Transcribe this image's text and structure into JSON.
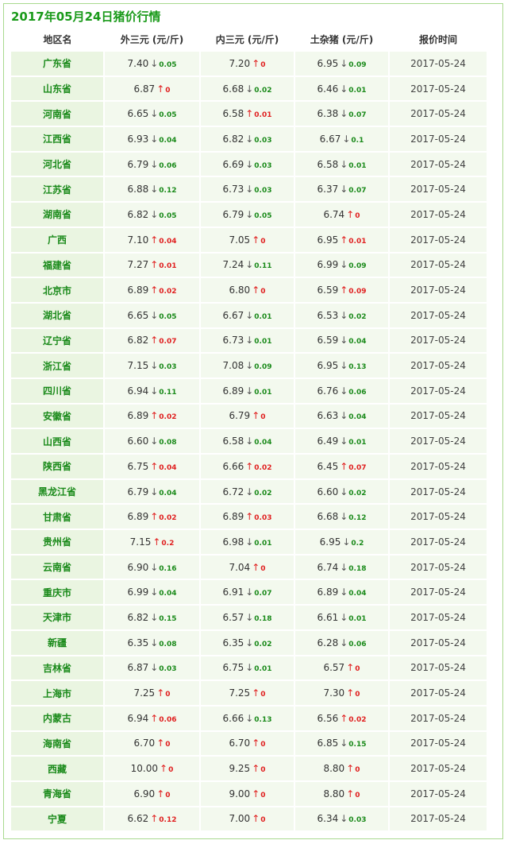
{
  "title": "2017年05月24日猪价行情",
  "headers": [
    "地区名",
    "外三元 (元/斤)",
    "内三元 (元/斤)",
    "土杂猪 (元/斤)",
    "报价时间"
  ],
  "colors": {
    "accent": "#1a9a1a",
    "up": "#e02020",
    "down": "#1a8a1a",
    "row_bg": "#f3f9ee",
    "border": "#a9d98e"
  },
  "rows": [
    {
      "region": "广东省",
      "c1": {
        "v": "7.40",
        "d": "down",
        "c": "0.05"
      },
      "c2": {
        "v": "7.20",
        "d": "up",
        "c": "0"
      },
      "c3": {
        "v": "6.95",
        "d": "down",
        "c": "0.09"
      },
      "date": "2017-05-24"
    },
    {
      "region": "山东省",
      "c1": {
        "v": "6.87",
        "d": "up",
        "c": "0"
      },
      "c2": {
        "v": "6.68",
        "d": "down",
        "c": "0.02"
      },
      "c3": {
        "v": "6.46",
        "d": "down",
        "c": "0.01"
      },
      "date": "2017-05-24"
    },
    {
      "region": "河南省",
      "c1": {
        "v": "6.65",
        "d": "down",
        "c": "0.05"
      },
      "c2": {
        "v": "6.58",
        "d": "up",
        "c": "0.01"
      },
      "c3": {
        "v": "6.38",
        "d": "down",
        "c": "0.07"
      },
      "date": "2017-05-24"
    },
    {
      "region": "江西省",
      "c1": {
        "v": "6.93",
        "d": "down",
        "c": "0.04"
      },
      "c2": {
        "v": "6.82",
        "d": "down",
        "c": "0.03"
      },
      "c3": {
        "v": "6.67",
        "d": "down",
        "c": "0.1"
      },
      "date": "2017-05-24"
    },
    {
      "region": "河北省",
      "c1": {
        "v": "6.79",
        "d": "down",
        "c": "0.06"
      },
      "c2": {
        "v": "6.69",
        "d": "down",
        "c": "0.03"
      },
      "c3": {
        "v": "6.58",
        "d": "down",
        "c": "0.01"
      },
      "date": "2017-05-24"
    },
    {
      "region": "江苏省",
      "c1": {
        "v": "6.88",
        "d": "down",
        "c": "0.12"
      },
      "c2": {
        "v": "6.73",
        "d": "down",
        "c": "0.03"
      },
      "c3": {
        "v": "6.37",
        "d": "down",
        "c": "0.07"
      },
      "date": "2017-05-24"
    },
    {
      "region": "湖南省",
      "c1": {
        "v": "6.82",
        "d": "down",
        "c": "0.05"
      },
      "c2": {
        "v": "6.79",
        "d": "down",
        "c": "0.05"
      },
      "c3": {
        "v": "6.74",
        "d": "up",
        "c": "0"
      },
      "date": "2017-05-24"
    },
    {
      "region": "广西",
      "c1": {
        "v": "7.10",
        "d": "up",
        "c": "0.04"
      },
      "c2": {
        "v": "7.05",
        "d": "up",
        "c": "0"
      },
      "c3": {
        "v": "6.95",
        "d": "up",
        "c": "0.01"
      },
      "date": "2017-05-24"
    },
    {
      "region": "福建省",
      "c1": {
        "v": "7.27",
        "d": "up",
        "c": "0.01"
      },
      "c2": {
        "v": "7.24",
        "d": "down",
        "c": "0.11"
      },
      "c3": {
        "v": "6.99",
        "d": "down",
        "c": "0.09"
      },
      "date": "2017-05-24"
    },
    {
      "region": "北京市",
      "c1": {
        "v": "6.89",
        "d": "up",
        "c": "0.02"
      },
      "c2": {
        "v": "6.80",
        "d": "up",
        "c": "0"
      },
      "c3": {
        "v": "6.59",
        "d": "up",
        "c": "0.09"
      },
      "date": "2017-05-24"
    },
    {
      "region": "湖北省",
      "c1": {
        "v": "6.65",
        "d": "down",
        "c": "0.05"
      },
      "c2": {
        "v": "6.67",
        "d": "down",
        "c": "0.01"
      },
      "c3": {
        "v": "6.53",
        "d": "down",
        "c": "0.02"
      },
      "date": "2017-05-24"
    },
    {
      "region": "辽宁省",
      "c1": {
        "v": "6.82",
        "d": "up",
        "c": "0.07"
      },
      "c2": {
        "v": "6.73",
        "d": "down",
        "c": "0.01"
      },
      "c3": {
        "v": "6.59",
        "d": "down",
        "c": "0.04"
      },
      "date": "2017-05-24"
    },
    {
      "region": "浙江省",
      "c1": {
        "v": "7.15",
        "d": "down",
        "c": "0.03"
      },
      "c2": {
        "v": "7.08",
        "d": "down",
        "c": "0.09"
      },
      "c3": {
        "v": "6.95",
        "d": "down",
        "c": "0.13"
      },
      "date": "2017-05-24"
    },
    {
      "region": "四川省",
      "c1": {
        "v": "6.94",
        "d": "down",
        "c": "0.11"
      },
      "c2": {
        "v": "6.89",
        "d": "down",
        "c": "0.01"
      },
      "c3": {
        "v": "6.76",
        "d": "down",
        "c": "0.06"
      },
      "date": "2017-05-24"
    },
    {
      "region": "安徽省",
      "c1": {
        "v": "6.89",
        "d": "up",
        "c": "0.02"
      },
      "c2": {
        "v": "6.79",
        "d": "up",
        "c": "0"
      },
      "c3": {
        "v": "6.63",
        "d": "down",
        "c": "0.04"
      },
      "date": "2017-05-24"
    },
    {
      "region": "山西省",
      "c1": {
        "v": "6.60",
        "d": "down",
        "c": "0.08"
      },
      "c2": {
        "v": "6.58",
        "d": "down",
        "c": "0.04"
      },
      "c3": {
        "v": "6.49",
        "d": "down",
        "c": "0.01"
      },
      "date": "2017-05-24"
    },
    {
      "region": "陕西省",
      "c1": {
        "v": "6.75",
        "d": "up",
        "c": "0.04"
      },
      "c2": {
        "v": "6.66",
        "d": "up",
        "c": "0.02"
      },
      "c3": {
        "v": "6.45",
        "d": "up",
        "c": "0.07"
      },
      "date": "2017-05-24"
    },
    {
      "region": "黑龙江省",
      "c1": {
        "v": "6.79",
        "d": "down",
        "c": "0.04"
      },
      "c2": {
        "v": "6.72",
        "d": "down",
        "c": "0.02"
      },
      "c3": {
        "v": "6.60",
        "d": "down",
        "c": "0.02"
      },
      "date": "2017-05-24"
    },
    {
      "region": "甘肃省",
      "c1": {
        "v": "6.89",
        "d": "up",
        "c": "0.02"
      },
      "c2": {
        "v": "6.89",
        "d": "up",
        "c": "0.03"
      },
      "c3": {
        "v": "6.68",
        "d": "down",
        "c": "0.12"
      },
      "date": "2017-05-24"
    },
    {
      "region": "贵州省",
      "c1": {
        "v": "7.15",
        "d": "up",
        "c": "0.2"
      },
      "c2": {
        "v": "6.98",
        "d": "down",
        "c": "0.01"
      },
      "c3": {
        "v": "6.95",
        "d": "down",
        "c": "0.2"
      },
      "date": "2017-05-24"
    },
    {
      "region": "云南省",
      "c1": {
        "v": "6.90",
        "d": "down",
        "c": "0.16"
      },
      "c2": {
        "v": "7.04",
        "d": "up",
        "c": "0"
      },
      "c3": {
        "v": "6.74",
        "d": "down",
        "c": "0.18"
      },
      "date": "2017-05-24"
    },
    {
      "region": "重庆市",
      "c1": {
        "v": "6.99",
        "d": "down",
        "c": "0.04"
      },
      "c2": {
        "v": "6.91",
        "d": "down",
        "c": "0.07"
      },
      "c3": {
        "v": "6.89",
        "d": "down",
        "c": "0.04"
      },
      "date": "2017-05-24"
    },
    {
      "region": "天津市",
      "c1": {
        "v": "6.82",
        "d": "down",
        "c": "0.15"
      },
      "c2": {
        "v": "6.57",
        "d": "down",
        "c": "0.18"
      },
      "c3": {
        "v": "6.61",
        "d": "down",
        "c": "0.01"
      },
      "date": "2017-05-24"
    },
    {
      "region": "新疆",
      "c1": {
        "v": "6.35",
        "d": "down",
        "c": "0.08"
      },
      "c2": {
        "v": "6.35",
        "d": "down",
        "c": "0.02"
      },
      "c3": {
        "v": "6.28",
        "d": "down",
        "c": "0.06"
      },
      "date": "2017-05-24"
    },
    {
      "region": "吉林省",
      "c1": {
        "v": "6.87",
        "d": "down",
        "c": "0.03"
      },
      "c2": {
        "v": "6.75",
        "d": "down",
        "c": "0.01"
      },
      "c3": {
        "v": "6.57",
        "d": "up",
        "c": "0"
      },
      "date": "2017-05-24"
    },
    {
      "region": "上海市",
      "c1": {
        "v": "7.25",
        "d": "up",
        "c": "0"
      },
      "c2": {
        "v": "7.25",
        "d": "up",
        "c": "0"
      },
      "c3": {
        "v": "7.30",
        "d": "up",
        "c": "0"
      },
      "date": "2017-05-24"
    },
    {
      "region": "内蒙古",
      "c1": {
        "v": "6.94",
        "d": "up",
        "c": "0.06"
      },
      "c2": {
        "v": "6.66",
        "d": "down",
        "c": "0.13"
      },
      "c3": {
        "v": "6.56",
        "d": "up",
        "c": "0.02"
      },
      "date": "2017-05-24"
    },
    {
      "region": "海南省",
      "c1": {
        "v": "6.70",
        "d": "up",
        "c": "0"
      },
      "c2": {
        "v": "6.70",
        "d": "up",
        "c": "0"
      },
      "c3": {
        "v": "6.85",
        "d": "down",
        "c": "0.15"
      },
      "date": "2017-05-24"
    },
    {
      "region": "西藏",
      "c1": {
        "v": "10.00",
        "d": "up",
        "c": "0"
      },
      "c2": {
        "v": "9.25",
        "d": "up",
        "c": "0"
      },
      "c3": {
        "v": "8.80",
        "d": "up",
        "c": "0"
      },
      "date": "2017-05-24"
    },
    {
      "region": "青海省",
      "c1": {
        "v": "6.90",
        "d": "up",
        "c": "0"
      },
      "c2": {
        "v": "9.00",
        "d": "up",
        "c": "0"
      },
      "c3": {
        "v": "8.80",
        "d": "up",
        "c": "0"
      },
      "date": "2017-05-24"
    },
    {
      "region": "宁夏",
      "c1": {
        "v": "6.62",
        "d": "up",
        "c": "0.12"
      },
      "c2": {
        "v": "7.00",
        "d": "up",
        "c": "0"
      },
      "c3": {
        "v": "6.34",
        "d": "down",
        "c": "0.03"
      },
      "date": "2017-05-24"
    }
  ]
}
